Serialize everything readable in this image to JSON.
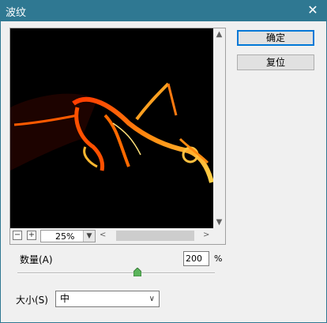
{
  "window": {
    "title": "波纹",
    "close_glyph": "✕"
  },
  "buttons": {
    "ok": "确定",
    "reset": "复位"
  },
  "preview": {
    "zoom_out": "−",
    "zoom_in": "+",
    "zoom_value": "25%",
    "scroll_up": "▲",
    "scroll_down": "▼",
    "scroll_left": "<",
    "scroll_right": ">",
    "dropdown_glyph": "▼"
  },
  "amount": {
    "label": "数量(A)",
    "value": "200",
    "unit": "%",
    "slider_fraction": 0.6
  },
  "size": {
    "label": "大小(S)",
    "selected": "中",
    "chevron": "∨"
  },
  "colors": {
    "titlebar": "#2f7892",
    "accent": "#0078d7"
  }
}
